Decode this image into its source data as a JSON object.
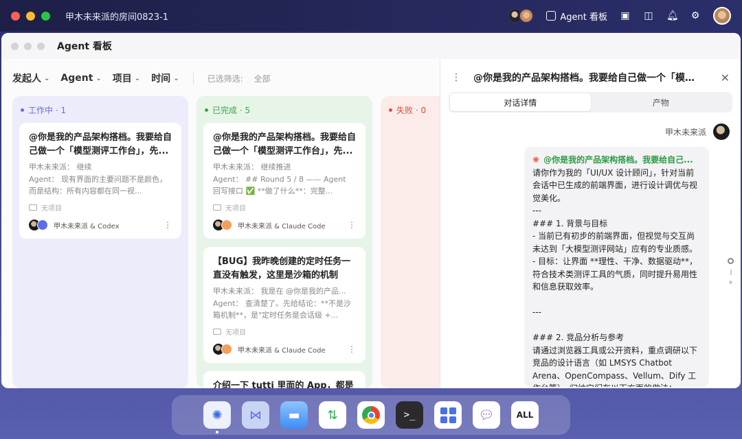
{
  "outer": {
    "room_title": "甲木未来派的房间0823-1",
    "board_button": "Agent 看板"
  },
  "window": {
    "title": "Agent 看板"
  },
  "filters": {
    "initiator": "发起人",
    "agent": "Agent",
    "project": "项目",
    "time": "时间",
    "selected_label": "已选筛选:",
    "selected_value": "全部"
  },
  "columns": {
    "working": {
      "label": "工作中 · 1"
    },
    "done": {
      "label": "已完成 · 5"
    },
    "failed": {
      "label": "失败 · 0"
    }
  },
  "cards": {
    "work1": {
      "title": "@你是我的产品架构搭档。我要给自己做一个「模型测评工作台」，先...",
      "user_line": "甲木未来派：  继续",
      "agent_line": "Agent：  现有界面的主要问题不是颜色，而是结构：所有内容都在同一视...",
      "project": "无项目",
      "footer": "甲木未来派 & Codex"
    },
    "done1": {
      "title": "@你是我的产品架构搭档。我要给自己做一个「模型测评工作台」，先...",
      "user_line": "甲木未来派：  继续推进",
      "agent_line": "Agent：  ## Round 5 / 8 —— Agent 回写接口 ✅ **做了什么**：完整...",
      "project": "无项目",
      "footer": "甲木未来派 & Claude Code"
    },
    "done2": {
      "title": "【BUG】我昨晚创建的定时任务一直没有触发，这里是沙箱的机制吗...",
      "user_line": "甲木未来派：  我是在 @你是我的产品...",
      "agent_line": "Agent：  查清楚了。先给结论：**不是沙箱机制**，是\"定时任务是会话级 +...",
      "project": "无项目",
      "footer": "甲木未来派 & Claude Code"
    },
    "done3": {
      "title": "介绍一下 tutti 里面的 App，都是"
    }
  },
  "panel": {
    "title": "@你是我的产品架构搭档。我要给自己做一个「模型...",
    "tab_detail": "对话详情",
    "tab_artifacts": "产物",
    "sender_name": "甲木未来派",
    "message_head": "@你是我的产品架构搭档。我要给自己...",
    "message_body": "请你作为我的「UI/UX 设计顾问」，针对当前会话中已生成的前端界面，进行设计调优与视觉美化。\n---\n### 1. 背景与目标\n- 当前已有初步的前端界面，但视觉与交互尚未达到「大模型测评网站」应有的专业质感。\n- 目标：让界面 **理性、干净、数据驱动**，符合技术类测评工具的气质，同时提升易用性和信息获取效率。\n\n---\n\n### 2. 竞品分析与参考\n请通过浏览器工具或公开资料，重点调研以下竞品的设计语言（如 LMSYS Chatbot Arena、OpenCompass、Vellum、Dify 工作台等），归纳它们在以下方面的做法："
  },
  "dock": {
    "all_label": "ALL",
    "terminal_glyph": ">_"
  },
  "colors": {
    "working": "#6b6bd8",
    "done": "#3aa64a",
    "failed": "#d9503f"
  }
}
